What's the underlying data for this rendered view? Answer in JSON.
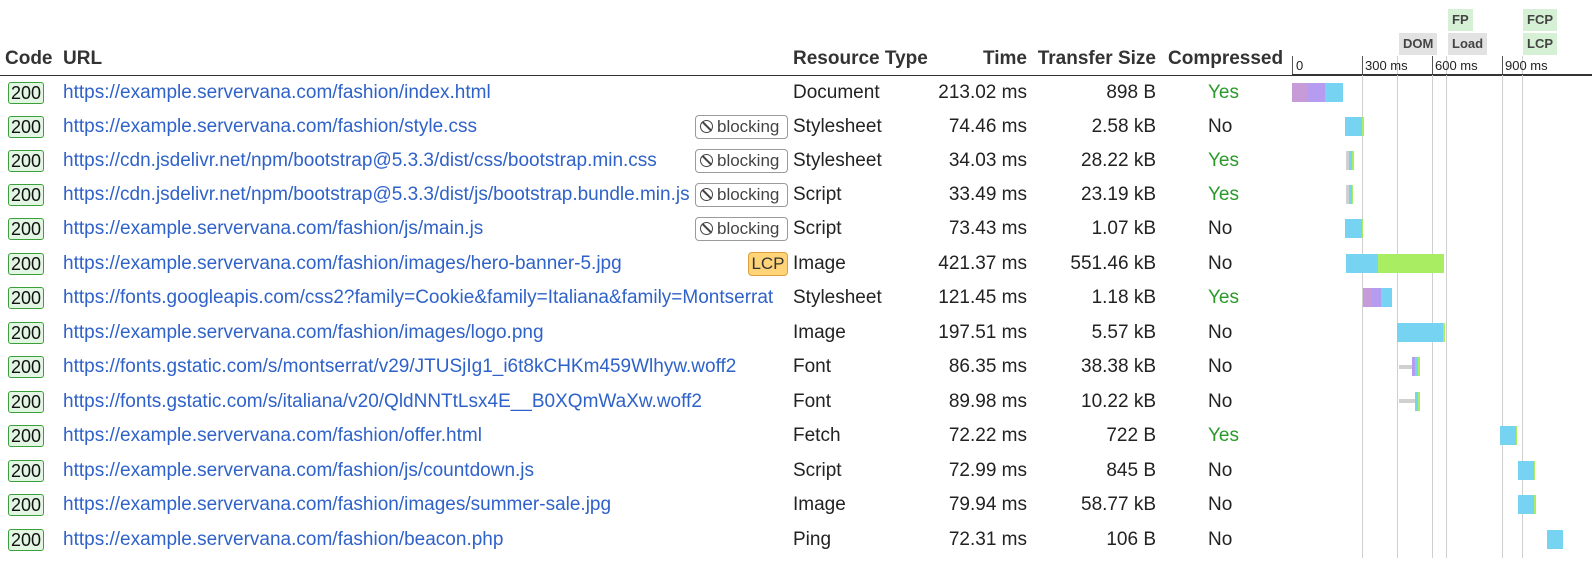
{
  "headers": {
    "code": "Code",
    "url": "URL",
    "resource_type": "Resource Type",
    "time": "Time",
    "transfer_size": "Transfer Size",
    "compressed": "Compressed"
  },
  "waterfall": {
    "ticks": [
      "0",
      "300 ms",
      "600 ms",
      "900 ms"
    ],
    "markers": {
      "fp": "FP",
      "fcp": "FCP",
      "dom": "DOM",
      "load": "Load",
      "lcp": "LCP"
    }
  },
  "tags": {
    "blocking": "blocking",
    "lcp": "LCP"
  },
  "colors": {
    "link": "#2f62c9",
    "yes": "#2a9a2a",
    "badge_border": "#3aa03a",
    "badge_bg": "#e3f6e3",
    "lcp_tag": "#ffd479",
    "bar_dns": "#c79ad8",
    "bar_connect": "#b59cf0",
    "bar_wait": "#76d3f2",
    "bar_download": "#a8ed62",
    "bar_queue": "#d0d0d0"
  },
  "rows": [
    {
      "code": "200",
      "url": "https://example.servervana.com/fashion/index.html",
      "tag": "",
      "type": "Document",
      "time": "213.02 ms",
      "size": "898 B",
      "compressed": "Yes"
    },
    {
      "code": "200",
      "url": "https://example.servervana.com/fashion/style.css",
      "tag": "blocking",
      "type": "Stylesheet",
      "time": "74.46 ms",
      "size": "2.58 kB",
      "compressed": "No"
    },
    {
      "code": "200",
      "url": "https://cdn.jsdelivr.net/npm/bootstrap@5.3.3/dist/css/bootstrap.min.css",
      "tag": "blocking",
      "type": "Stylesheet",
      "time": "34.03 ms",
      "size": "28.22 kB",
      "compressed": "Yes"
    },
    {
      "code": "200",
      "url": "https://cdn.jsdelivr.net/npm/bootstrap@5.3.3/dist/js/bootstrap.bundle.min.js",
      "tag": "blocking",
      "type": "Script",
      "time": "33.49 ms",
      "size": "23.19 kB",
      "compressed": "Yes"
    },
    {
      "code": "200",
      "url": "https://example.servervana.com/fashion/js/main.js",
      "tag": "blocking",
      "type": "Script",
      "time": "73.43 ms",
      "size": "1.07 kB",
      "compressed": "No"
    },
    {
      "code": "200",
      "url": "https://example.servervana.com/fashion/images/hero-banner-5.jpg",
      "tag": "lcp",
      "type": "Image",
      "time": "421.37 ms",
      "size": "551.46 kB",
      "compressed": "No"
    },
    {
      "code": "200",
      "url": "https://fonts.googleapis.com/css2?family=Cookie&family=Italiana&family=Montserrat",
      "tag": "",
      "type": "Stylesheet",
      "time": "121.45 ms",
      "size": "1.18 kB",
      "compressed": "Yes"
    },
    {
      "code": "200",
      "url": "https://example.servervana.com/fashion/images/logo.png",
      "tag": "",
      "type": "Image",
      "time": "197.51 ms",
      "size": "5.57 kB",
      "compressed": "No"
    },
    {
      "code": "200",
      "url": "https://fonts.gstatic.com/s/montserrat/v29/JTUSjIg1_i6t8kCHKm459Wlhyw.woff2",
      "tag": "",
      "type": "Font",
      "time": "86.35 ms",
      "size": "38.38 kB",
      "compressed": "No"
    },
    {
      "code": "200",
      "url": "https://fonts.gstatic.com/s/italiana/v20/QldNNTtLsx4E__B0XQmWaXw.woff2",
      "tag": "",
      "type": "Font",
      "time": "89.98 ms",
      "size": "10.22 kB",
      "compressed": "No"
    },
    {
      "code": "200",
      "url": "https://example.servervana.com/fashion/offer.html",
      "tag": "",
      "type": "Fetch",
      "time": "72.22 ms",
      "size": "722 B",
      "compressed": "Yes"
    },
    {
      "code": "200",
      "url": "https://example.servervana.com/fashion/js/countdown.js",
      "tag": "",
      "type": "Script",
      "time": "72.99 ms",
      "size": "845 B",
      "compressed": "No"
    },
    {
      "code": "200",
      "url": "https://example.servervana.com/fashion/images/summer-sale.jpg",
      "tag": "",
      "type": "Image",
      "time": "79.94 ms",
      "size": "58.77 kB",
      "compressed": "No"
    },
    {
      "code": "200",
      "url": "https://example.servervana.com/fashion/beacon.php",
      "tag": "",
      "type": "Ping",
      "time": "72.31 ms",
      "size": "106 B",
      "compressed": "No"
    }
  ]
}
